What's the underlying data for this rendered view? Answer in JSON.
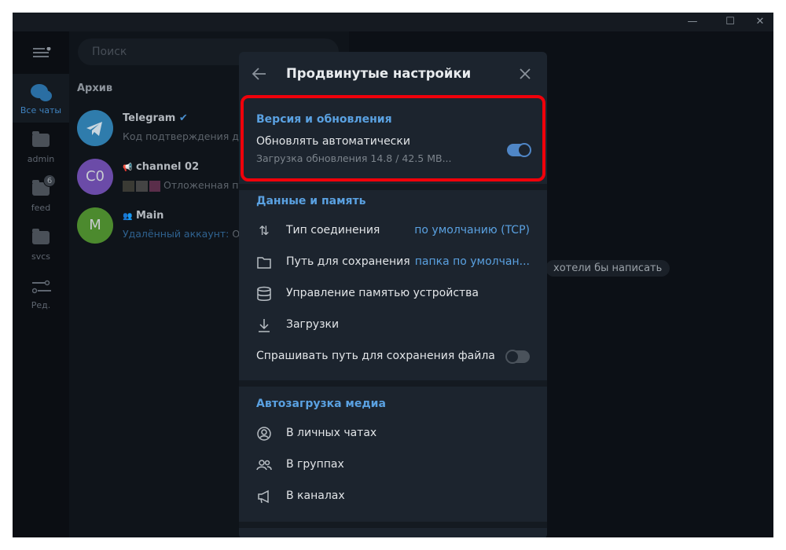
{
  "window": {
    "controls": {
      "minimize": "—",
      "maximize": "☐",
      "close": "✕"
    }
  },
  "rail": {
    "items": [
      {
        "label": "Все чаты",
        "icon": "chats-icon",
        "active": true
      },
      {
        "label": "admin",
        "icon": "folder-icon"
      },
      {
        "label": "feed",
        "icon": "folder-icon",
        "badge": "6"
      },
      {
        "label": "svcs",
        "icon": "folder-icon"
      },
      {
        "label": "Ред.",
        "icon": "edit-filters-icon"
      }
    ]
  },
  "chatlist": {
    "search_placeholder": "Поиск",
    "archive_label": "Архив",
    "chats": [
      {
        "name": "Telegram",
        "avatar": "",
        "color": "#2f7cac",
        "message": "Код подтверждения для",
        "verified": true
      },
      {
        "name": "channel 02",
        "avatar": "C0",
        "color": "#6b4ba8",
        "message": "Отложенная пу",
        "type": "channel"
      },
      {
        "name": "Main",
        "avatar": "M",
        "color": "#4c8a2e",
        "message_sender": "Удалённый аккаунт:",
        "message": " Отл",
        "type": "group"
      }
    ]
  },
  "main": {
    "hint": "хотели бы написать"
  },
  "modal": {
    "title": "Продвинутые настройки",
    "sections": {
      "version": {
        "header": "Версия и обновления",
        "auto_update_label": "Обновлять автоматически",
        "auto_update_status": "Загрузка обновления 14.8 / 42.5 MB...",
        "auto_update_on": true
      },
      "data": {
        "header": "Данные и память",
        "items": [
          {
            "label": "Тип соединения",
            "value": "по умолчанию (TCP)",
            "icon": "arrows-up-down-icon"
          },
          {
            "label": "Путь для сохранения",
            "value": "папка по умолчан...",
            "icon": "folder-outline-icon"
          },
          {
            "label": "Управление памятью устройства",
            "icon": "database-icon"
          },
          {
            "label": "Загрузки",
            "icon": "download-icon"
          }
        ],
        "ask_path_label": "Спрашивать путь для сохранения файла",
        "ask_path_on": false
      },
      "media": {
        "header": "Автозагрузка медиа",
        "items": [
          {
            "label": "В личных чатах",
            "icon": "user-circle-icon"
          },
          {
            "label": "В группах",
            "icon": "users-icon"
          },
          {
            "label": "В каналах",
            "icon": "megaphone-icon"
          }
        ]
      }
    }
  },
  "colors": {
    "accent": "#5aa1e1",
    "highlight": "#f0000a"
  }
}
